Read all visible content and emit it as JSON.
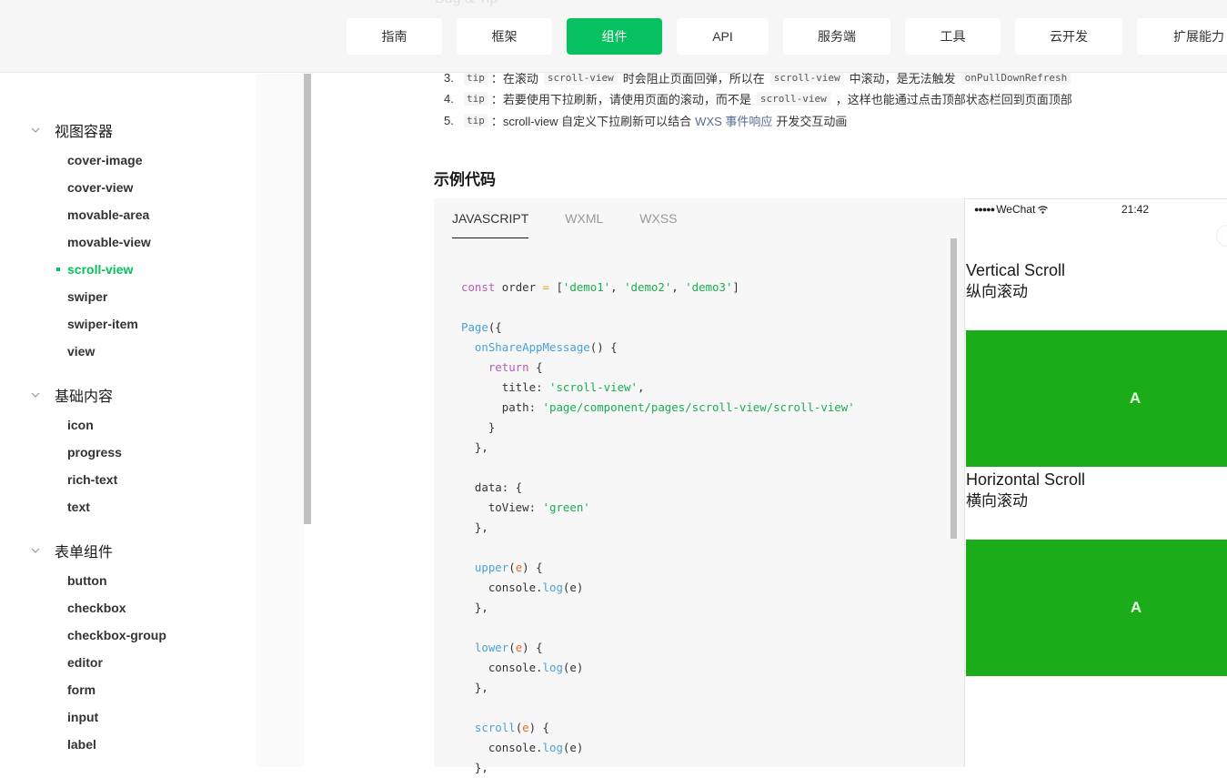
{
  "topnav": {
    "ghost_title": "Bug & Tip",
    "items": [
      {
        "label": "指南",
        "active": false
      },
      {
        "label": "框架",
        "active": false
      },
      {
        "label": "组件",
        "active": true
      },
      {
        "label": "API",
        "active": false
      },
      {
        "label": "服务端",
        "active": false
      },
      {
        "label": "工具",
        "active": false
      },
      {
        "label": "云开发",
        "active": false
      },
      {
        "label": "扩展能力",
        "active": false
      }
    ]
  },
  "sidebar": {
    "groups": [
      {
        "title": "视图容器",
        "items": [
          "cover-image",
          "cover-view",
          "movable-area",
          "movable-view",
          "scroll-view",
          "swiper",
          "swiper-item",
          "view"
        ],
        "active_item": "scroll-view"
      },
      {
        "title": "基础内容",
        "items": [
          "icon",
          "progress",
          "rich-text",
          "text"
        ]
      },
      {
        "title": "表单组件",
        "items": [
          "button",
          "checkbox",
          "checkbox-group",
          "editor",
          "form",
          "input",
          "label"
        ]
      }
    ]
  },
  "tips": [
    {
      "num": "3.",
      "tag": "tip",
      "parts": [
        "：在滚动",
        "scroll-view",
        "时会阻止页面回弹，所以在",
        "scroll-view",
        "中滚动，是无法触发",
        "onPullDownRefresh"
      ]
    },
    {
      "num": "4.",
      "tag": "tip",
      "parts": [
        "：若要使用下拉刷新，请使用页面的滚动，而不是",
        "scroll-view",
        "，这样也能通过点击顶部状态栏回到页面顶部"
      ]
    },
    {
      "num": "5.",
      "tag": "tip",
      "text_before": "：scroll-view 自定义下拉刷新可以结合",
      "link": "WXS 事件响应",
      "text_after": "开发交互动画"
    }
  ],
  "example": {
    "title": "示例代码",
    "tabs": [
      {
        "label": "JAVASCRIPT",
        "active": true
      },
      {
        "label": "WXML",
        "active": false
      },
      {
        "label": "WXSS",
        "active": false
      }
    ],
    "code": {
      "const_kw": "const",
      "order_decl": " order ",
      "eq": "=",
      "arr_open": " [",
      "demo1": "'demo1'",
      "demo2": "'demo2'",
      "demo3": "'demo3'",
      "arr_close": "]",
      "page_fn": "Page",
      "page_open": "({",
      "share_fn": "onShareAppMessage",
      "share_rest": "() {",
      "return_kw": "return",
      "return_rest": " {",
      "title_key": "title: ",
      "title_val": "'scroll-view'",
      "path_key": "path: ",
      "path_val": "'page/component/pages/scroll-view/scroll-view'",
      "close_brace": "}",
      "close_brace_comma": "},",
      "data_key": "data: {",
      "toview_key": "toView: ",
      "toview_val": "'green'",
      "upper_fn": "upper",
      "lower_fn": "lower",
      "scroll_fn": "scroll",
      "param": "e",
      "console": "console.",
      "log_fn": "log",
      "log_args": "(e)"
    }
  },
  "preview": {
    "carrier": "WeChat",
    "signal_dots": "●●●●●",
    "time": "21:42",
    "vertical_title": "Vertical Scroll",
    "vertical_sub": "纵向滚动",
    "horizontal_title": "Horizontal Scroll",
    "horizontal_sub": "横向滚动",
    "block_label": "A",
    "block_color": "#1aad19"
  },
  "colors": {
    "brand_green": "#07c160",
    "link": "#576b95"
  }
}
